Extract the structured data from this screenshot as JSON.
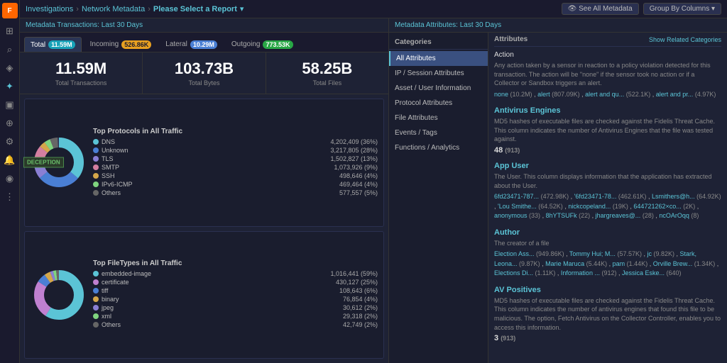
{
  "sidebar": {
    "logo": "F",
    "icons": [
      {
        "name": "grid-icon",
        "symbol": "⊞",
        "active": false
      },
      {
        "name": "search-icon",
        "symbol": "🔍",
        "active": false
      },
      {
        "name": "shield-icon",
        "symbol": "🛡",
        "active": false
      },
      {
        "name": "fingerprint-icon",
        "symbol": "👆",
        "active": true
      },
      {
        "name": "monitor-icon",
        "symbol": "🖥",
        "active": false
      },
      {
        "name": "wrench-icon",
        "symbol": "🔧",
        "active": false
      },
      {
        "name": "settings-icon",
        "symbol": "⚙",
        "active": false
      },
      {
        "name": "alert-icon",
        "symbol": "🔔",
        "active": false
      },
      {
        "name": "user-icon",
        "symbol": "👤",
        "active": false
      },
      {
        "name": "dots-icon",
        "symbol": "⋮",
        "active": false
      }
    ]
  },
  "breadcrumb": {
    "items": [
      "Investigations",
      "Network Metadata",
      "Please Select a Report"
    ],
    "dropdown": "▾"
  },
  "top_bar": {
    "see_all_metadata": "👁 See All Metadata",
    "group_by": "Group By Columns ▾"
  },
  "left_panel": {
    "header": "Metadata Transactions: Last 30 Days",
    "tabs": [
      {
        "label": "Total",
        "badge": "11.59M",
        "badge_class": "badge-teal",
        "active": true
      },
      {
        "label": "Incoming",
        "badge": "526.86K",
        "badge_class": "badge-orange",
        "active": false
      },
      {
        "label": "Lateral",
        "badge": "10.29M",
        "badge_class": "badge-blue",
        "active": false
      },
      {
        "label": "Outgoing",
        "badge": "773.53K",
        "badge_class": "badge-green",
        "active": false
      }
    ],
    "metrics": [
      {
        "value": "11.59M",
        "label": "Total Transactions"
      },
      {
        "value": "103.73B",
        "label": "Total Bytes"
      },
      {
        "value": "58.25B",
        "label": "Total Files"
      }
    ],
    "chart1": {
      "title": "Top Protocols in All Traffic",
      "items": [
        {
          "label": "DNS",
          "value": "4,202,409 (36%)",
          "color": "#5bc4d6",
          "pct": 36
        },
        {
          "label": "Unknown",
          "value": "3,217,805 (28%)",
          "color": "#4a7fd4",
          "pct": 28
        },
        {
          "label": "TLS",
          "value": "1,502,827 (13%)",
          "color": "#8a7fd4",
          "pct": 13
        },
        {
          "label": "SMTP",
          "value": "1,073,926 (9%)",
          "color": "#d47fa0",
          "pct": 9
        },
        {
          "label": "SSH",
          "value": "498,646 (4%)",
          "color": "#d4a74a",
          "pct": 4
        },
        {
          "label": "IPv6-ICMP",
          "value": "469,464 (4%)",
          "color": "#7fd47f",
          "pct": 4
        },
        {
          "label": "Others",
          "value": "577,557 (5%)",
          "color": "#666",
          "pct": 5
        }
      ]
    },
    "chart2": {
      "title": "Top FileTypes in All Traffic",
      "items": [
        {
          "label": "embedded-image",
          "value": "1,016,441 (59%)",
          "color": "#5bc4d6",
          "pct": 59
        },
        {
          "label": "certificate",
          "value": "430,127 (25%)",
          "color": "#c080d0",
          "pct": 25
        },
        {
          "label": "tiff",
          "value": "108,643 (6%)",
          "color": "#4a7fd4",
          "pct": 6
        },
        {
          "label": "binary",
          "value": "76,854 (4%)",
          "color": "#d4a74a",
          "pct": 4
        },
        {
          "label": "jpeg",
          "value": "30,612 (2%)",
          "color": "#8a7fd4",
          "pct": 2
        },
        {
          "label": "xml",
          "value": "29,318 (2%)",
          "color": "#7fd47f",
          "pct": 2
        },
        {
          "label": "Others",
          "value": "42,749 (2%)",
          "color": "#666",
          "pct": 2
        }
      ]
    }
  },
  "right_panel": {
    "header": "Metadata Attributes: Last 30 Days",
    "categories": {
      "title": "Categories",
      "items": [
        {
          "label": "All Attributes",
          "active": true
        },
        {
          "label": "IP / Session Attributes",
          "active": false
        },
        {
          "label": "Asset / User Information",
          "active": false
        },
        {
          "label": "Protocol Attributes",
          "active": false
        },
        {
          "label": "File Attributes",
          "active": false
        },
        {
          "label": "Events / Tags",
          "active": false
        },
        {
          "label": "Functions / Analytics",
          "active": false
        }
      ]
    },
    "attributes": {
      "title": "Attributes",
      "show_related": "Show Related Categories",
      "sections": [
        {
          "type": "plain",
          "header": "Action",
          "description": "Any action taken by a sensor in reaction to a policy violation detected for this transaction. The action will be \"none\" if the sensor took no action or if a Collector or Sandbox triggers an alert.",
          "tags": "none (10.2M) , alert (807.09K) , alert and qu... (522.1K) , alert and pr... (4.97K)"
        },
        {
          "type": "header",
          "header": "Antivirus Engines",
          "description": "MD5 hashes of executable files are checked against the Fidelis Threat Cache. This column indicates the number of Antivirus Engines that the file was tested against.",
          "number": "48",
          "number_sub": "(913)"
        },
        {
          "type": "header",
          "header": "App User",
          "description": "The User. This column displays information that the application has extracted about the User.",
          "tags": "6fd23471-787... (472.98K) , '6fd23471-78... (462.61K) , Lsmithers@h... (64.92K) , 'Lou Smithe... (64.52K) , nickcopeland... (19K) , 644721262×co... (2K) , anonymous (33) , 8hYTSUFk (22) , jhargreaves@... (28) , ncOArOqq (8)"
        },
        {
          "type": "header",
          "header": "Author",
          "description": "The creator of a file",
          "tags": "Election Ass... (949.86K) , Tommy Hui; M... (57.57K) , jc (9.82K) , Stark, Leona... (9.87K) , Marie Maruca (5.44K) , pam (1.44K) , Orville Brew... (1.34K) , Elections Di... (1.11K) , Information ... (912) , Jessica Eske... (640)"
        },
        {
          "type": "header",
          "header": "AV Positives",
          "description": "MD5 hashes of executable files are checked against the Fidelis Threat Cache. This column indicates the number of antivirus engines that found this file to be malicious. The option, Fetch Antivirus on the Collector Controller, enables you to access this information.",
          "number": "3",
          "number_sub": "(913)"
        }
      ]
    }
  }
}
